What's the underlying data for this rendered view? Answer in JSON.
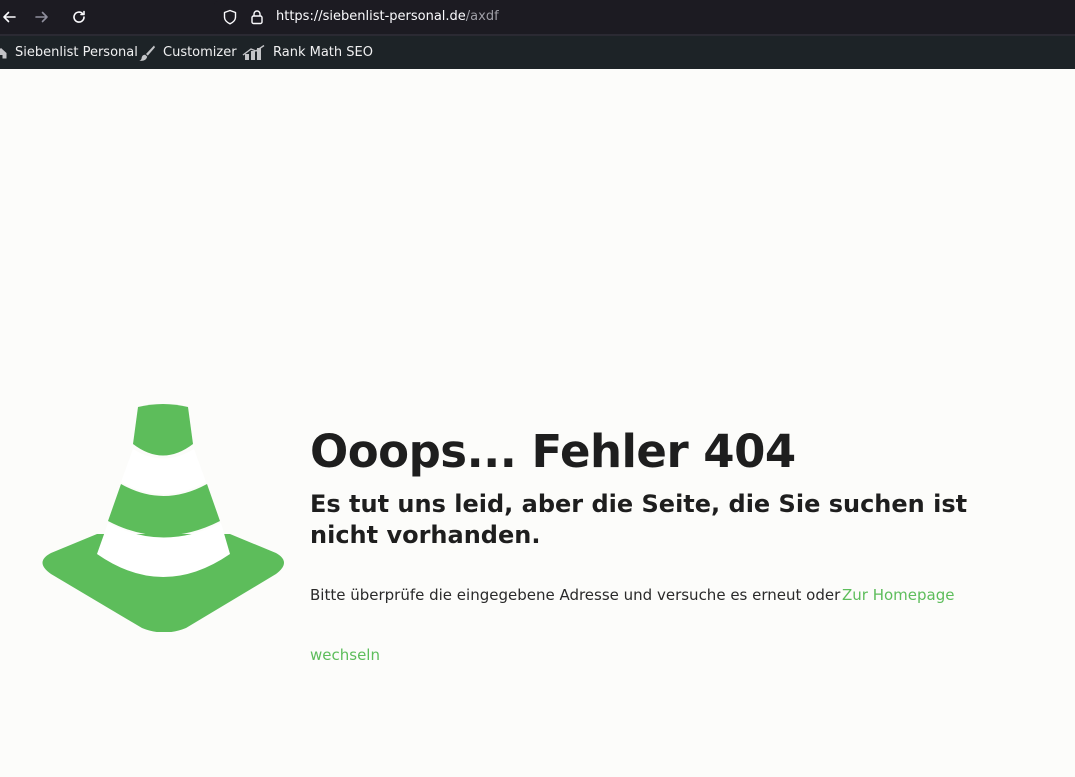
{
  "browser": {
    "url_host": "https://siebenlist-personal.de",
    "url_path": "/axdf"
  },
  "admin_bar": {
    "items": [
      {
        "label": "Siebenlist Personal",
        "icon": "home-icon"
      },
      {
        "label": "Customizer",
        "icon": "paintbrush-icon"
      },
      {
        "label": "Rank Math SEO",
        "icon": "rank-math-icon"
      }
    ]
  },
  "error_page": {
    "heading": "Ooops... Fehler 404",
    "subheading": "Es tut uns leid, aber die Seite, die Sie suchen ist nicht vorhanden.",
    "message": "Bitte überprüfe die eingegebene Adresse und versuche es erneut oder",
    "link_label_1": "Zur Homepage",
    "link_label_2": "wechseln",
    "illustration": "traffic-cone-icon"
  },
  "colors": {
    "accent_green": "#5dbd5b",
    "admin_bar": "#1d2327",
    "browser_chrome": "#1c1b22",
    "background": "#fcfcfa"
  }
}
